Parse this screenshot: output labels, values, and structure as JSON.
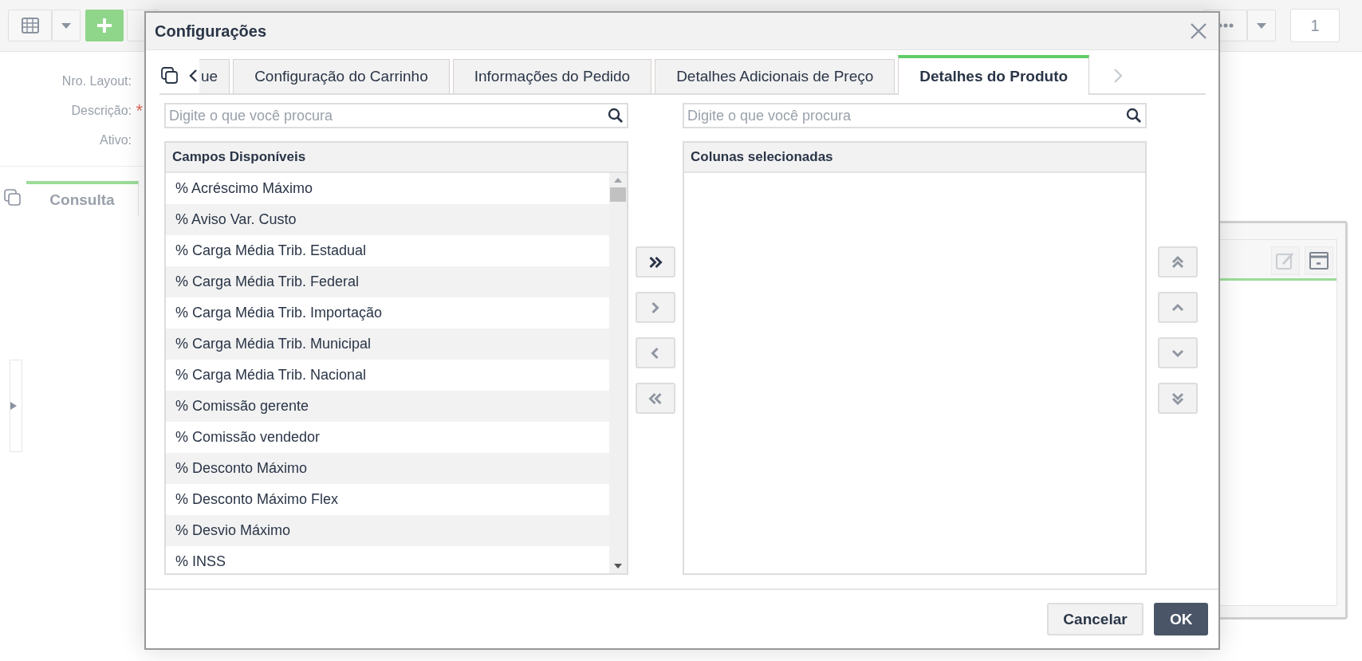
{
  "toolbar": {
    "page_number": "1"
  },
  "form": {
    "fields": [
      {
        "label": "Nro. Layout:"
      },
      {
        "label": "Descrição:",
        "required_mark": "*"
      },
      {
        "label": "Ativo:"
      }
    ]
  },
  "page_tabs": [
    {
      "label": "Consulta",
      "selected": true
    }
  ],
  "dialog": {
    "title": "Configurações",
    "tabs": [
      {
        "label": "ue",
        "selected": false
      },
      {
        "label": "Configuração do Carrinho",
        "selected": false
      },
      {
        "label": "Informações do Pedido",
        "selected": false
      },
      {
        "label": "Detalhes Adicionais de Preço",
        "selected": false
      },
      {
        "label": "Detalhes do Produto",
        "selected": true
      }
    ],
    "available": {
      "placeholder": "Digite o que você procura",
      "header": "Campos Disponíveis",
      "items": [
        "% Acréscimo Máximo",
        "% Aviso Var. Custo",
        "% Carga Média Trib. Estadual",
        "% Carga Média Trib. Federal",
        "% Carga Média Trib. Importação",
        "% Carga Média Trib. Municipal",
        "% Carga Média Trib. Nacional",
        "% Comissão gerente",
        "% Comissão vendedor",
        "% Desconto Máximo",
        "% Desconto Máximo Flex",
        "% Desvio Máximo",
        "% INSS"
      ]
    },
    "selected_columns": {
      "placeholder": "Digite o que você procura",
      "header": "Colunas selecionadas"
    },
    "transfer_buttons": [
      {
        "kind": "add_all",
        "disabled": false
      },
      {
        "kind": "add",
        "disabled": true
      },
      {
        "kind": "remove",
        "disabled": true
      },
      {
        "kind": "remove_all",
        "disabled": true
      }
    ],
    "order_buttons": [
      {
        "kind": "top",
        "disabled": true
      },
      {
        "kind": "up",
        "disabled": true
      },
      {
        "kind": "down",
        "disabled": true
      },
      {
        "kind": "bottom",
        "disabled": true
      }
    ],
    "buttons": [
      {
        "label": "Cancelar",
        "kind": "secondary"
      },
      {
        "label": "OK",
        "kind": "primary"
      }
    ]
  }
}
